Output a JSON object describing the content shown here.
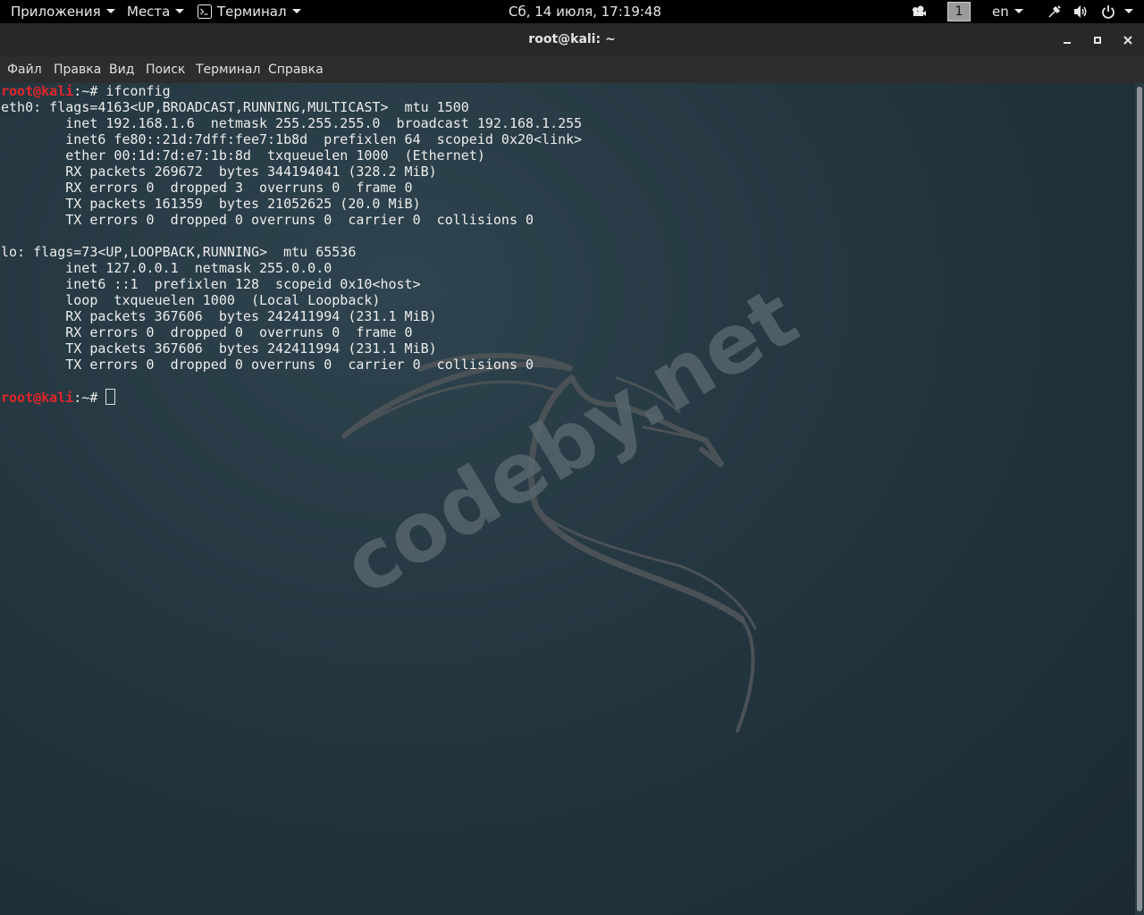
{
  "topbar": {
    "applications": "Приложения",
    "places": "Места",
    "terminal_app": "Терминал",
    "datetime": "Сб, 14 июля, 17:19:48",
    "workspace": "1",
    "keyboard_layout": "en"
  },
  "window": {
    "title": "root@kali: ~"
  },
  "menu": [
    "Файл",
    "Правка",
    "Вид",
    "Поиск",
    "Терминал",
    "Справка"
  ],
  "prompt": {
    "user_host": "root@kali",
    "sep": ":~# "
  },
  "terminal": {
    "command": "ifconfig",
    "output_lines": [
      "eth0: flags=4163<UP,BROADCAST,RUNNING,MULTICAST>  mtu 1500",
      "        inet 192.168.1.6  netmask 255.255.255.0  broadcast 192.168.1.255",
      "        inet6 fe80::21d:7dff:fee7:1b8d  prefixlen 64  scopeid 0x20<link>",
      "        ether 00:1d:7d:e7:1b:8d  txqueuelen 1000  (Ethernet)",
      "        RX packets 269672  bytes 344194041 (328.2 MiB)",
      "        RX errors 0  dropped 3  overruns 0  frame 0",
      "        TX packets 161359  bytes 21052625 (20.0 MiB)",
      "        TX errors 0  dropped 0 overruns 0  carrier 0  collisions 0",
      "",
      "lo: flags=73<UP,LOOPBACK,RUNNING>  mtu 65536",
      "        inet 127.0.0.1  netmask 255.0.0.0",
      "        inet6 ::1  prefixlen 128  scopeid 0x10<host>",
      "        loop  txqueuelen 1000  (Local Loopback)",
      "        RX packets 367606  bytes 242411994 (231.1 MiB)",
      "        RX errors 0  dropped 0  overruns 0  frame 0",
      "        TX packets 367606  bytes 242411994 (231.1 MiB)",
      "        TX errors 0  dropped 0 overruns 0  carrier 0  collisions 0",
      ""
    ]
  },
  "watermark": {
    "text": "codeby.net"
  },
  "icons": {
    "terminal_app": "terminal-icon",
    "screen": "display-icon",
    "network": "network-icon",
    "volume": "volume-icon",
    "power": "power-icon",
    "minimize": "minimize-icon",
    "maximize": "maximize-icon",
    "close": "close-icon"
  },
  "colors": {
    "prompt_user": "#e0262b",
    "text": "#ececec",
    "background": "#243640"
  }
}
